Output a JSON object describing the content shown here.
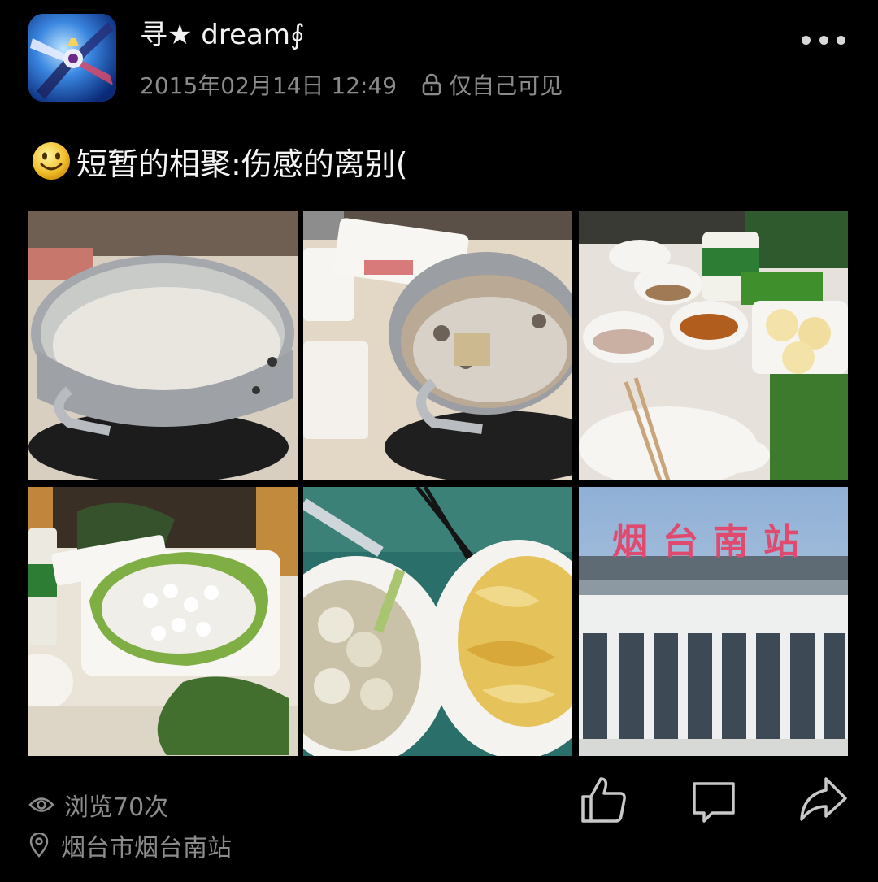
{
  "post": {
    "author": {
      "name": "寻★ dream∮",
      "avatar_icon": "gundam-avatar-icon"
    },
    "date": "2015年02月14日 12:49",
    "visibility": "仅自己可见",
    "text": "短暂的相聚:伤感的离别(",
    "emoji": "smiley-face-icon",
    "images": [
      {
        "desc": "hotpot-pot-broth"
      },
      {
        "desc": "hotpot-pot-with-meat"
      },
      {
        "desc": "sauces-tofu-vegetables"
      },
      {
        "desc": "shrimp-balls-on-lettuce"
      },
      {
        "desc": "cauliflower-and-fried-shrimp"
      },
      {
        "desc": "yantai-south-station",
        "sign_text": "烟台南站"
      }
    ],
    "stats": {
      "views": "浏览70次"
    },
    "location": "烟台市烟台南站"
  },
  "actions": {
    "like": "like-icon",
    "comment": "comment-icon",
    "share": "share-icon"
  },
  "colors": {
    "background": "#000000",
    "primary_text": "#f2f2f2",
    "secondary_text": "#8a8a8a"
  }
}
